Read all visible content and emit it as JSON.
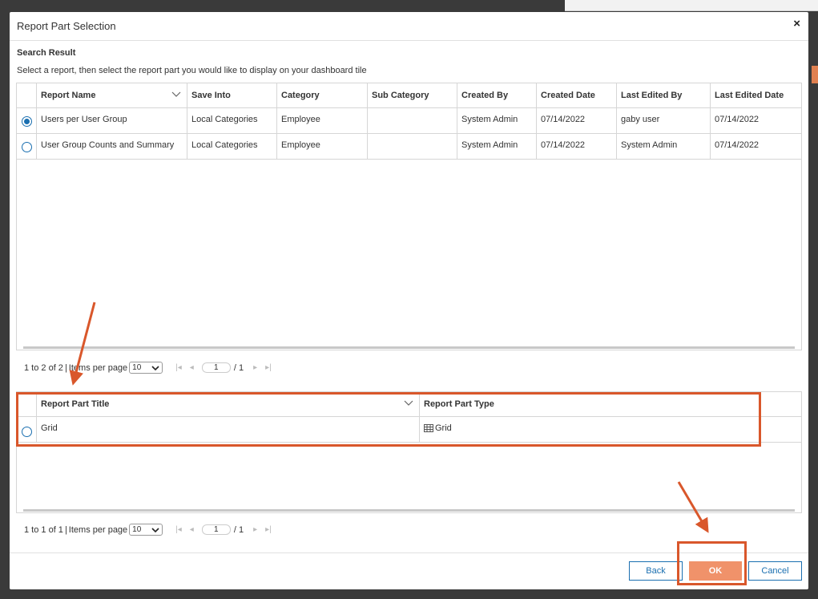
{
  "modal": {
    "title": "Report Part Selection",
    "close_glyph": "×"
  },
  "search": {
    "section_title": "Search Result",
    "instruction": "Select a report, then select the report part you would like to display on your dashboard tile"
  },
  "reports": {
    "columns": [
      "Report Name",
      "Save Into",
      "Category",
      "Sub Category",
      "Created By",
      "Created Date",
      "Last Edited By",
      "Last Edited Date"
    ],
    "rows": [
      {
        "selected": true,
        "cells": [
          "Users per User Group",
          "Local Categories",
          "Employee",
          "",
          "System Admin",
          "07/14/2022",
          "gaby user",
          "07/14/2022"
        ]
      },
      {
        "selected": false,
        "cells": [
          "User Group Counts and Summary",
          "Local Categories",
          "Employee",
          "",
          "System Admin",
          "07/14/2022",
          "System Admin",
          "07/14/2022"
        ]
      }
    ],
    "pager": {
      "range": "1 to 2 of 2",
      "sep": "|",
      "items_label": "Items per page",
      "per_page": "10",
      "page": "1",
      "total": "/ 1"
    }
  },
  "parts": {
    "columns": [
      "Report Part Title",
      "Report Part Type"
    ],
    "rows": [
      {
        "selected": false,
        "title": "Grid",
        "type": "Grid",
        "type_icon": "grid-icon"
      }
    ],
    "pager": {
      "range": "1 to 1 of 1",
      "sep": "|",
      "items_label": "Items per page",
      "per_page": "10",
      "page": "1",
      "total": "/ 1"
    }
  },
  "buttons": {
    "back": "Back",
    "ok": "OK",
    "cancel": "Cancel"
  },
  "colors": {
    "accent_blue": "#1a6fb0",
    "ok_orange": "#f0926a",
    "annotation": "#d9572b"
  },
  "icons": {
    "first": "first-page-icon",
    "prev": "prev-page-icon",
    "next": "next-page-icon",
    "last": "last-page-icon",
    "sort": "sort-chevron-icon"
  }
}
